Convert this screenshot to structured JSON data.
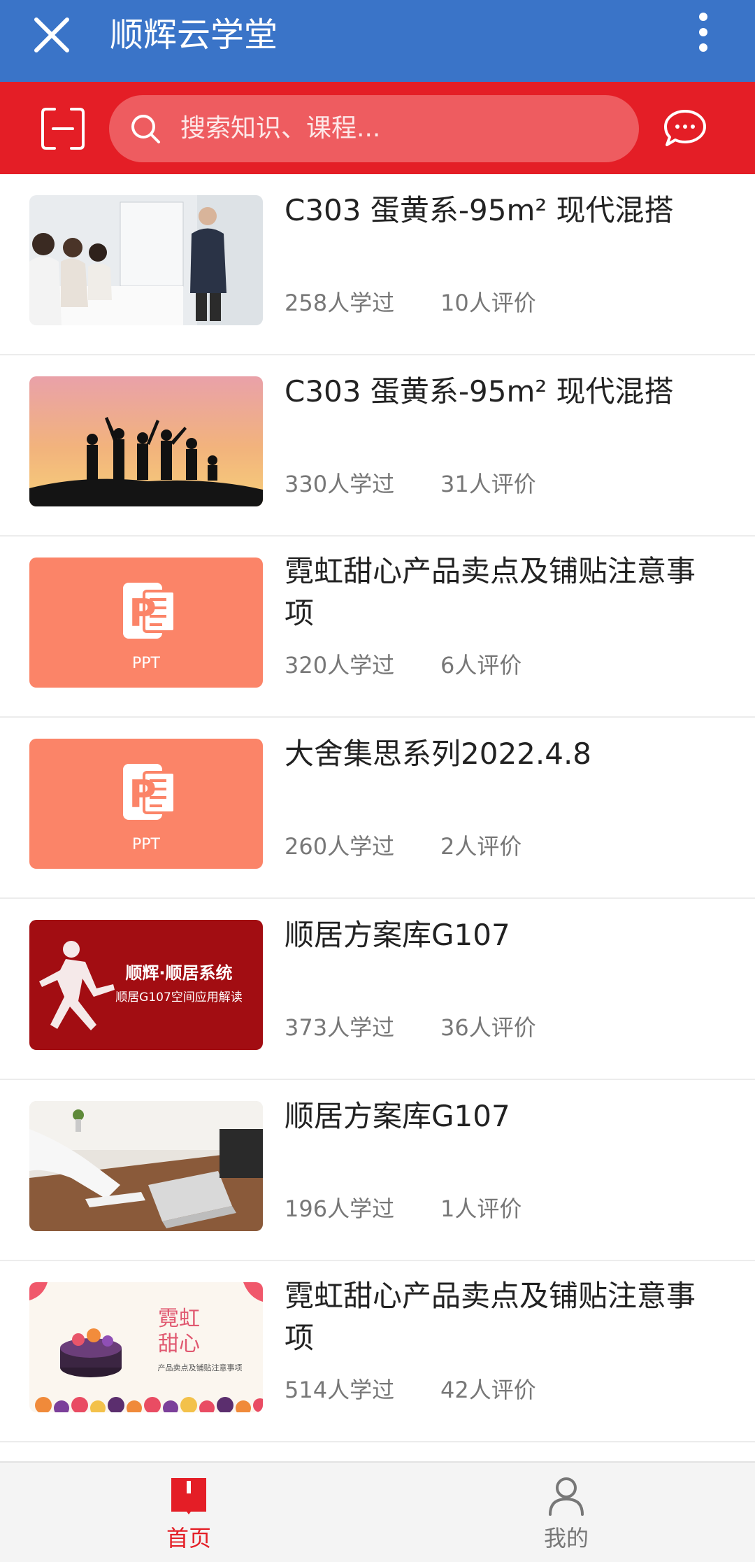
{
  "header": {
    "title": "顺辉云学堂",
    "bg_color": "#3a74c8",
    "close_icon": "close-icon",
    "more_icon": "more-vertical-icon"
  },
  "search": {
    "placeholder": "搜索知识、课程...",
    "bg_color": "#e41e26",
    "scan_icon": "scan-icon",
    "chat_icon": "chat-bubble-icon"
  },
  "courses": [
    {
      "title": "C303 蛋黄系-95m² 现代混搭",
      "learned": "258人学过",
      "reviews": "10人评价",
      "thumb": "meeting-photo"
    },
    {
      "title": "C303 蛋黄系-95m² 现代混搭",
      "learned": "330人学过",
      "reviews": "31人评价",
      "thumb": "sunset-silhouette-photo"
    },
    {
      "title": "霓虹甜心产品卖点及铺贴注意事项",
      "learned": "320人学过",
      "reviews": "6人评价",
      "thumb": "ppt-cover",
      "thumb_label": "PPT"
    },
    {
      "title": "大舍集思系列2022.4.8",
      "learned": "260人学过",
      "reviews": "2人评价",
      "thumb": "ppt-cover",
      "thumb_label": "PPT"
    },
    {
      "title": "顺居方案库G107",
      "learned": "373人学过",
      "reviews": "36人评价",
      "thumb": "runner-poster",
      "thumb_line1": "顺辉·顺居系统",
      "thumb_line2": "顺居G107空间应用解读"
    },
    {
      "title": "顺居方案库G107",
      "learned": "196人学过",
      "reviews": "1人评价",
      "thumb": "laptop-desk-photo"
    },
    {
      "title": "霓虹甜心产品卖点及铺贴注意事项",
      "learned": "514人学过",
      "reviews": "42人评价",
      "thumb": "cake-poster",
      "thumb_line1": "霓虹",
      "thumb_line2": "甜心",
      "thumb_line3": "产品卖点及铺贴注意事项"
    }
  ],
  "nav": {
    "home_label": "首页",
    "mine_label": "我的",
    "active_color": "#e41e26"
  }
}
